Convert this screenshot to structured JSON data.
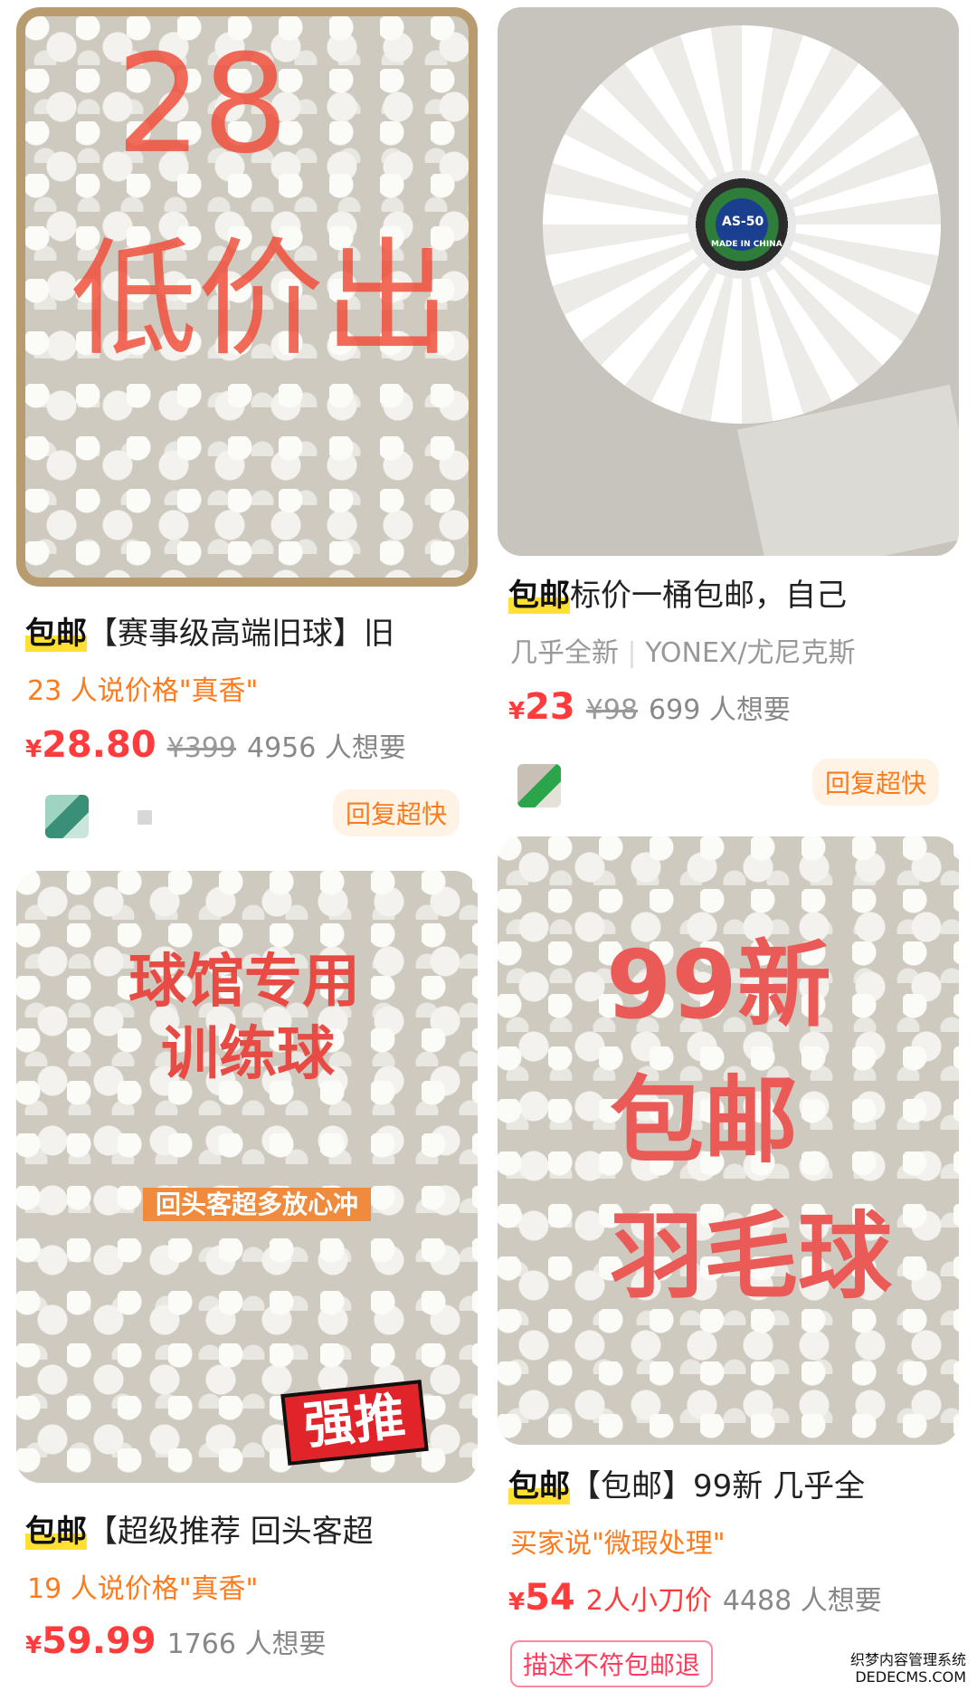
{
  "cards": [
    {
      "image_overlay": [
        "28",
        "低价出"
      ],
      "badge": "包邮",
      "title": "【赛事级高端旧球】旧",
      "tag_line": "23 人说价格\"真香\"",
      "price_symbol": "¥",
      "price": "28.80",
      "original_price": "¥399",
      "want": "4956 人想要",
      "chip": "回复超快"
    },
    {
      "image_overlay": [
        "AS-50",
        "MADE IN CHINA"
      ],
      "badge": "包邮",
      "title": "标价一桶包邮，自己",
      "sub_left": "几乎全新",
      "sub_right": "YONEX/尤尼克斯",
      "price_symbol": "¥",
      "price": "23",
      "original_price": "¥98",
      "want": "699 人想要",
      "chip": "回复超快"
    },
    {
      "image_overlay": [
        "球馆专用",
        "训练球",
        "回头客超多放心冲",
        "强推"
      ],
      "badge": "包邮",
      "title": "【超级推荐 回头客超",
      "tag_line": "19 人说价格\"真香\"",
      "price_symbol": "¥",
      "price": "59.99",
      "want": "1766 人想要"
    },
    {
      "image_overlay": [
        "99新",
        "包邮",
        "羽毛球"
      ],
      "badge": "包邮",
      "title": "【包邮】99新 几乎全",
      "tag_line": "买家说\"微瑕处理\"",
      "price_symbol": "¥",
      "price": "54",
      "haggle": "2人小刀价",
      "want": "4488 人想要",
      "chip": "描述不符包邮退"
    }
  ],
  "watermark": [
    "织梦内容管理系统",
    "DEDECMS.COM"
  ],
  "colors": {
    "price": "#ff3b3b",
    "chip_text": "#ff7a1a",
    "badge_highlight": "#ffe033"
  }
}
